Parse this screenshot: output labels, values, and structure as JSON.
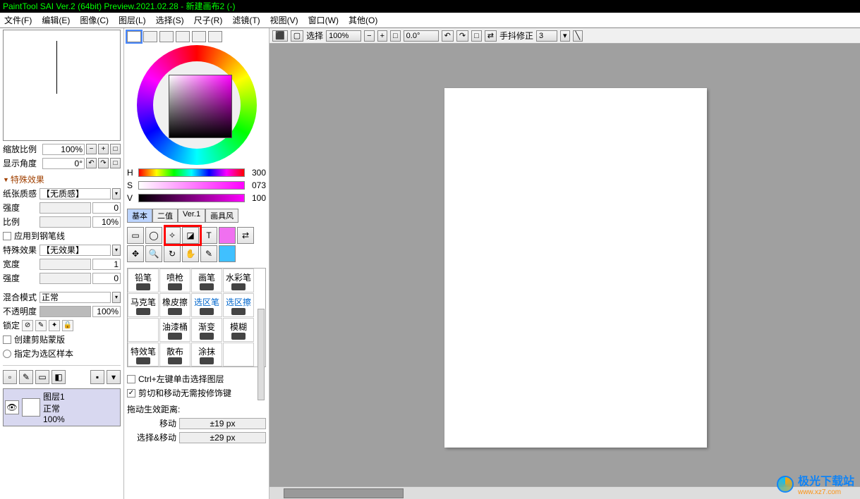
{
  "title": "PaintTool SAI Ver.2 (64bit) Preview.2021.02.28 - 新建画布2 (-)",
  "menu": {
    "file": "文件(F)",
    "edit": "编辑(E)",
    "image": "图像(C)",
    "layer": "图层(L)",
    "select": "选择(S)",
    "ruler": "尺子(R)",
    "filter": "滤镜(T)",
    "view": "视图(V)",
    "window": "窗口(W)",
    "other": "其他(O)"
  },
  "nav": {
    "zoom_label": "缩放比例",
    "zoom_value": "100%",
    "angle_label": "显示角度",
    "angle_value": "0°"
  },
  "fx": {
    "header": "特殊效果",
    "paper_label": "纸张质感",
    "paper_value": "【无质感】",
    "strength_label": "强度",
    "strength_value": "0",
    "ratio_label": "比例",
    "ratio_value": "10%",
    "apply_pen": "应用到钢笔线",
    "special_label": "特殊效果",
    "special_value": "【无效果】",
    "width_label": "宽度",
    "width_value": "1",
    "strength2_label": "强度",
    "strength2_value": "0"
  },
  "blend": {
    "mode_label": "混合模式",
    "mode_value": "正常",
    "opacity_label": "不透明度",
    "opacity_value": "100%",
    "lock_label": "锁定",
    "clip_label": "创建剪贴蒙版",
    "selsample_label": "指定为选区样本"
  },
  "layer": {
    "name": "图层1",
    "mode": "正常",
    "opacity": "100%"
  },
  "hsv": {
    "h": "H",
    "h_val": "300",
    "s": "S",
    "s_val": "073",
    "v": "V",
    "v_val": "100"
  },
  "tooltabs": {
    "basic": "基本",
    "bin": "二值",
    "ver1": "Ver.1",
    "art": "画具风"
  },
  "brushes": [
    "铅笔",
    "喷枪",
    "画笔",
    "水彩笔",
    "马克笔",
    "橡皮擦",
    "选区笔",
    "选区擦",
    "",
    "油漆桶",
    "渐变",
    "模糊",
    "特效笔",
    "散布",
    "涂抹",
    ""
  ],
  "opts": {
    "ctrl_click": "Ctrl+左键单击选择图层",
    "cut_move": "剪切和移动无需按修饰键",
    "drag_header": "拖动生效距离:",
    "move_label": "移动",
    "move_value": "±19 px",
    "selmove_label": "选择&移动",
    "selmove_value": "±29 px"
  },
  "canvas_toolbar": {
    "select": "选择",
    "zoom": "100%",
    "angle": "0.0°",
    "stabilize": "手抖修正",
    "stabilize_value": "3"
  },
  "watermark": {
    "text": "极光下载站",
    "url": "www.xz7.com"
  }
}
